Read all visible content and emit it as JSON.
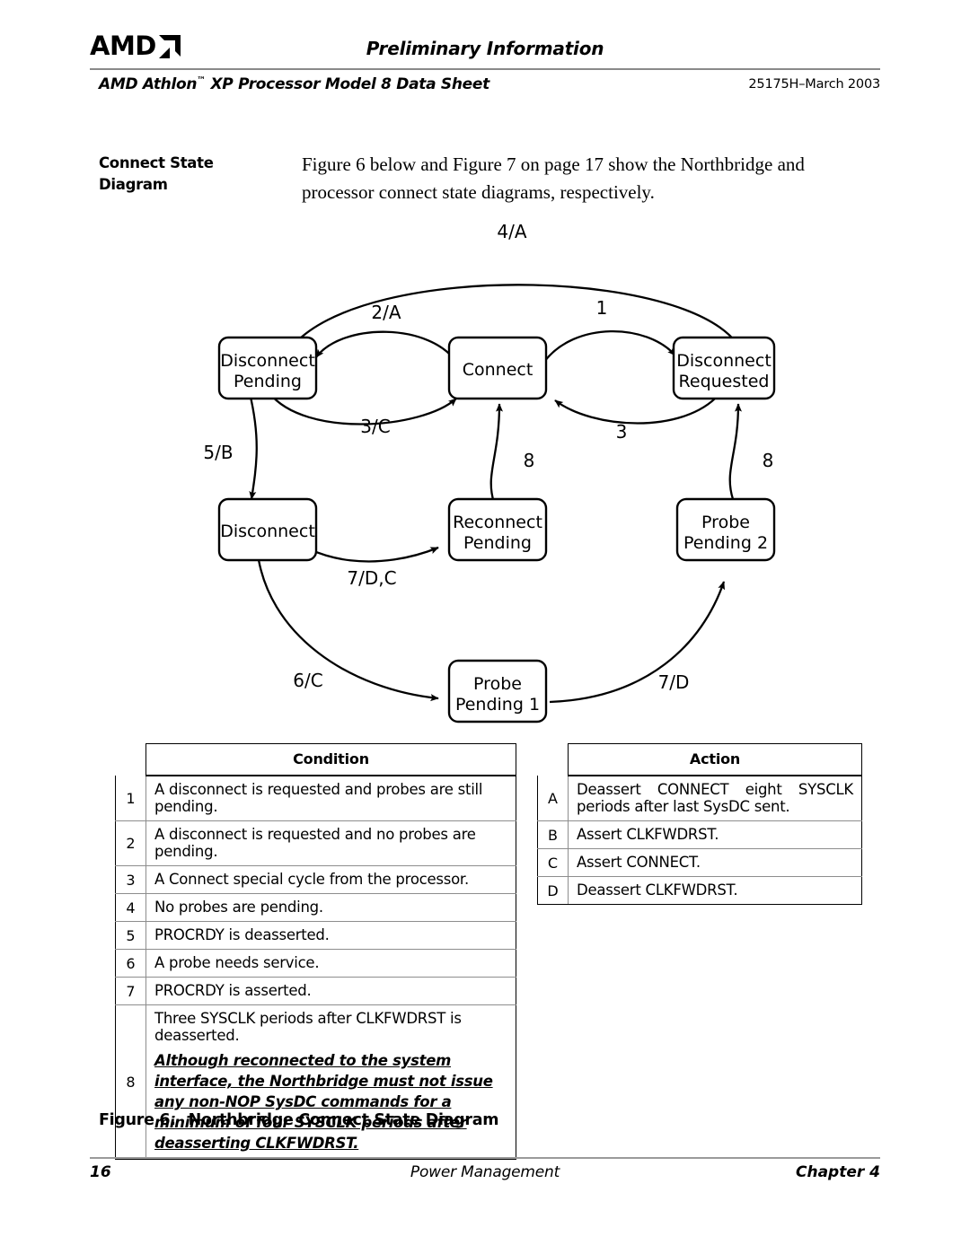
{
  "header": {
    "logo_text": "AMD",
    "logo_mark": "amd-arrow-icon",
    "preliminary": "Preliminary Information",
    "doc_title": "AMD Athlon",
    "doc_title_tm": "™",
    "doc_title_rest": " XP Processor Model 8 Data Sheet",
    "doc_id": "25175H–March 2003"
  },
  "intro": {
    "side_heading_line1": "Connect State",
    "side_heading_line2": "Diagram",
    "body": "Figure 6 below and Figure 7 on page 17 show the Northbridge and processor connect state diagrams, respectively."
  },
  "diagram": {
    "nodes": [
      {
        "id": "disconnect-pending",
        "line1": "Disconnect",
        "line2": "Pending"
      },
      {
        "id": "connect",
        "line1": "Connect",
        "line2": ""
      },
      {
        "id": "disconnect-requested",
        "line1": "Disconnect",
        "line2": "Requested"
      },
      {
        "id": "disconnect",
        "line1": "Disconnect",
        "line2": ""
      },
      {
        "id": "reconnect-pending",
        "line1": "Reconnect",
        "line2": "Pending"
      },
      {
        "id": "probe-pending-2",
        "line1": "Probe",
        "line2": "Pending 2"
      },
      {
        "id": "probe-pending-1",
        "line1": "Probe",
        "line2": "Pending 1"
      }
    ],
    "edges": [
      {
        "id": "edge-4a",
        "label": "4/A",
        "from": "disconnect-requested",
        "to": "disconnect-pending"
      },
      {
        "id": "edge-2a",
        "label": "2/A",
        "from": "connect",
        "to": "disconnect-pending"
      },
      {
        "id": "edge-3c",
        "label": "3/C",
        "from": "disconnect-pending",
        "to": "connect"
      },
      {
        "id": "edge-1",
        "label": "1",
        "from": "connect",
        "to": "disconnect-requested"
      },
      {
        "id": "edge-3",
        "label": "3",
        "from": "disconnect-requested",
        "to": "connect"
      },
      {
        "id": "edge-5b",
        "label": "5/B",
        "from": "disconnect-pending",
        "to": "disconnect"
      },
      {
        "id": "edge-8a",
        "label": "8",
        "from": "reconnect-pending",
        "to": "connect"
      },
      {
        "id": "edge-8b",
        "label": "8",
        "from": "probe-pending-2",
        "to": "disconnect-requested"
      },
      {
        "id": "edge-7dc",
        "label": "7/D,C",
        "from": "disconnect",
        "to": "reconnect-pending"
      },
      {
        "id": "edge-6c",
        "label": "6/C",
        "from": "disconnect",
        "to": "probe-pending-1"
      },
      {
        "id": "edge-7d",
        "label": "7/D",
        "from": "probe-pending-1",
        "to": "probe-pending-2"
      }
    ]
  },
  "condition_table": {
    "header": "Condition",
    "rows": [
      {
        "key": "1",
        "text": "A disconnect is requested and probes are still pending."
      },
      {
        "key": "2",
        "text": "A disconnect is requested and no probes are pending."
      },
      {
        "key": "3",
        "text": "A Connect special cycle from the processor."
      },
      {
        "key": "4",
        "text": "No probes are pending."
      },
      {
        "key": "5",
        "text": "PROCRDY is deasserted."
      },
      {
        "key": "6",
        "text": "A probe needs service."
      },
      {
        "key": "7",
        "text": "PROCRDY is asserted."
      },
      {
        "key": "8",
        "text": "Three SYSCLK periods after CLKFWDRST is deasserted.",
        "note": "Although reconnected to the system interface, the Northbridge must not issue any non-NOP SysDC commands for a minimum of four SYSCLK periods after deasserting CLKFWDRST."
      }
    ]
  },
  "action_table": {
    "header": "Action",
    "rows": [
      {
        "key": "A",
        "text": "Deassert CONNECT eight SYSCLK periods after last SysDC sent."
      },
      {
        "key": "B",
        "text": "Assert CLKFWDRST."
      },
      {
        "key": "C",
        "text": "Assert CONNECT."
      },
      {
        "key": "D",
        "text": "Deassert CLKFWDRST."
      }
    ]
  },
  "caption": {
    "number": "Figure 6.",
    "title": "Northbridge Connect State Diagram"
  },
  "footer": {
    "page": "16",
    "section": "Power Management",
    "chapter": "Chapter 4"
  }
}
